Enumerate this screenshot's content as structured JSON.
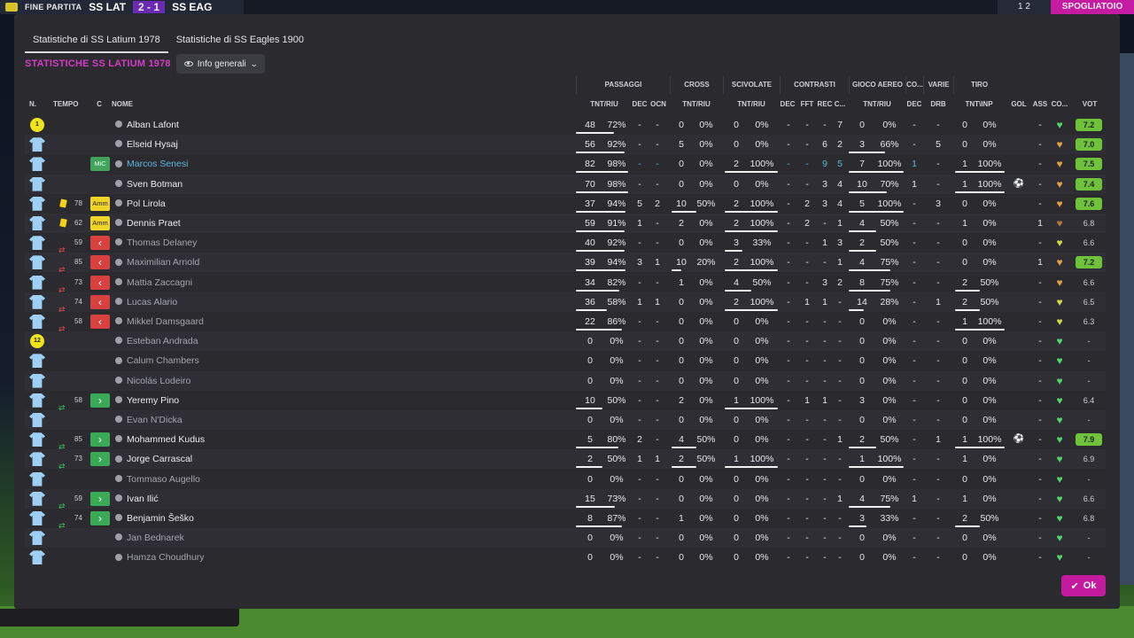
{
  "topbar": {
    "match_label": "FINE PARTITA",
    "home": "SS LAT",
    "score": "2 - 1",
    "away": "SS EAG",
    "page": "1 2",
    "room_button": "SPOGLIATOIO"
  },
  "tabs": [
    {
      "label": "Statistiche di SS Latium 1978",
      "active": true
    },
    {
      "label": "Statistiche di SS Eagles 1900",
      "active": false
    }
  ],
  "section_title": "STATISTICHE SS LATIUM 1978",
  "view_dropdown": "Info generali",
  "groups": [
    "PASSAGGI",
    "CROSS",
    "SCIVOLATE",
    "CONTRASTI",
    "GIOCO AEREO",
    "CO...",
    "VARIE",
    "TIRO"
  ],
  "headers": {
    "n": "N.",
    "tempo": "TEMPO",
    "c": "C",
    "nome": "NOME",
    "pass_tr": "TNT/RIU",
    "pass_dec": "DEC",
    "pass_ocn": "OCN",
    "cross_tr": "TNT/RIU",
    "sciv_tr": "TNT/RIU",
    "con_dec": "DEC",
    "con_fft": "FFT",
    "con_rec": "REC",
    "con_c": "C...",
    "aer_tr": "TNT/RIU",
    "co_dec": "DEC",
    "var_drb": "DRB",
    "tiro_tr": "TNT\\INP",
    "gol": "GOL",
    "ass": "ASS",
    "cond": "CO...",
    "vot": "VOT"
  },
  "colors": {
    "accent": "#c41b9e",
    "title": "#d43cc6",
    "vote_high": "#6ec33a",
    "vote_mid": "#9bd34a",
    "shirt": "#9dd0f4",
    "heart_green": "#4ed66a",
    "heart_orange": "#e0a040",
    "heart_yellow": "#cfd84a"
  },
  "players": [
    {
      "n": "1",
      "gk": true,
      "tempo": "",
      "tag": "",
      "tagType": "",
      "name": "Alban Lafont",
      "style": "",
      "pt": "48",
      "pr": "72%",
      "pd": "-",
      "po": "-",
      "ct": "0",
      "cr": "0%",
      "st": "0",
      "sr": "0%",
      "cd": "-",
      "cf": "-",
      "cre": "-",
      "cc": "7",
      "at": "0",
      "ar": "0%",
      "cod": "-",
      "drb": "-",
      "tt": "0",
      "tr": "0%",
      "gol": "",
      "ass": "-",
      "heart": "green",
      "vot": "7.2",
      "votStyle": "high",
      "passFill": 0.72,
      "crossFill": 0,
      "scivFill": 0,
      "aerFill": 0,
      "tiroFill": 0
    },
    {
      "n": "",
      "gk": false,
      "tempo": "",
      "tag": "",
      "tagType": "",
      "name": "Elseid Hysaj",
      "style": "",
      "pt": "56",
      "pr": "92%",
      "pd": "-",
      "po": "-",
      "ct": "5",
      "cr": "0%",
      "st": "0",
      "sr": "0%",
      "cd": "-",
      "cf": "-",
      "cre": "6",
      "cc": "2",
      "at": "3",
      "ar": "66%",
      "cod": "-",
      "drb": "5",
      "tt": "0",
      "tr": "0%",
      "gol": "",
      "ass": "-",
      "heart": "orange",
      "vot": "7.0",
      "votStyle": "high",
      "passFill": 0.92,
      "crossFill": 0,
      "scivFill": 0,
      "aerFill": 0.66,
      "tiroFill": 0
    },
    {
      "n": "",
      "gk": false,
      "tempo": "",
      "tag": "MiC",
      "tagType": "mic",
      "name": "Marcos Senesi",
      "style": "link",
      "pt": "82",
      "pr": "98%",
      "pd": "-",
      "po": "-",
      "ct": "0",
      "cr": "0%",
      "st": "2",
      "sr": "100%",
      "cd": "-",
      "cf": "-",
      "cre": "9",
      "cc": "5",
      "at": "7",
      "ar": "100%",
      "cod": "1",
      "drb": "-",
      "tt": "1",
      "tr": "100%",
      "gol": "",
      "ass": "-",
      "heart": "orange",
      "vot": "7.5",
      "votStyle": "high",
      "passFill": 0.98,
      "crossFill": 0,
      "scivFill": 1,
      "aerFill": 1,
      "tiroFill": 1,
      "teal": true
    },
    {
      "n": "",
      "gk": false,
      "tempo": "",
      "tag": "",
      "tagType": "",
      "name": "Sven Botman",
      "style": "",
      "pt": "70",
      "pr": "98%",
      "pd": "-",
      "po": "-",
      "ct": "0",
      "cr": "0%",
      "st": "0",
      "sr": "0%",
      "cd": "-",
      "cf": "-",
      "cre": "3",
      "cc": "4",
      "at": "10",
      "ar": "70%",
      "cod": "1",
      "drb": "-",
      "tt": "1",
      "tr": "100%",
      "gol": "⚽",
      "ass": "-",
      "heart": "orange",
      "vot": "7.4",
      "votStyle": "high",
      "passFill": 0.98,
      "crossFill": 0,
      "scivFill": 0,
      "aerFill": 0.7,
      "tiroFill": 1
    },
    {
      "n": "",
      "gk": false,
      "tempo": "78",
      "tempoIcon": "yellow",
      "tag": "Amm",
      "tagType": "amm",
      "name": "Pol Lirola",
      "style": "",
      "pt": "37",
      "pr": "94%",
      "pd": "5",
      "po": "2",
      "ct": "10",
      "cr": "50%",
      "st": "2",
      "sr": "100%",
      "cd": "-",
      "cf": "2",
      "cre": "3",
      "cc": "4",
      "at": "5",
      "ar": "100%",
      "cod": "-",
      "drb": "3",
      "tt": "0",
      "tr": "0%",
      "gol": "",
      "ass": "-",
      "heart": "orange",
      "vot": "7.6",
      "votStyle": "high",
      "passFill": 0.94,
      "crossFill": 0.5,
      "scivFill": 1,
      "aerFill": 1,
      "tiroFill": 0
    },
    {
      "n": "",
      "gk": false,
      "tempo": "62",
      "tempoIcon": "yellow",
      "tag": "Amm",
      "tagType": "amm",
      "name": "Dennis Praet",
      "style": "",
      "pt": "59",
      "pr": "91%",
      "pd": "1",
      "po": "-",
      "ct": "2",
      "cr": "0%",
      "st": "2",
      "sr": "100%",
      "cd": "-",
      "cf": "2",
      "cre": "-",
      "cc": "1",
      "at": "4",
      "ar": "50%",
      "cod": "-",
      "drb": "-",
      "tt": "1",
      "tr": "0%",
      "gol": "",
      "ass": "1",
      "heart": "brown",
      "vot": "6.8",
      "votStyle": "plain",
      "passFill": 0.91,
      "crossFill": 0,
      "scivFill": 1,
      "aerFill": 0.5,
      "tiroFill": 0
    },
    {
      "n": "",
      "gk": false,
      "tempo": "59",
      "tempoIcon": "out",
      "tag": "‹",
      "tagType": "out",
      "name": "Thomas Delaney",
      "style": "sub",
      "pt": "40",
      "pr": "92%",
      "pd": "-",
      "po": "-",
      "ct": "0",
      "cr": "0%",
      "st": "3",
      "sr": "33%",
      "cd": "-",
      "cf": "-",
      "cre": "1",
      "cc": "3",
      "at": "2",
      "ar": "50%",
      "cod": "-",
      "drb": "-",
      "tt": "0",
      "tr": "0%",
      "gol": "",
      "ass": "-",
      "heart": "yellow",
      "vot": "6.6",
      "votStyle": "plain",
      "passFill": 0.92,
      "crossFill": 0,
      "scivFill": 0.33,
      "aerFill": 0.5,
      "tiroFill": 0
    },
    {
      "n": "",
      "gk": false,
      "tempo": "85",
      "tempoIcon": "out",
      "tag": "‹",
      "tagType": "out",
      "name": "Maximilian Arnold",
      "style": "sub",
      "pt": "39",
      "pr": "94%",
      "pd": "3",
      "po": "1",
      "ct": "10",
      "cr": "20%",
      "st": "2",
      "sr": "100%",
      "cd": "-",
      "cf": "-",
      "cre": "-",
      "cc": "1",
      "at": "4",
      "ar": "75%",
      "cod": "-",
      "drb": "-",
      "tt": "0",
      "tr": "0%",
      "gol": "",
      "ass": "1",
      "heart": "orange",
      "vot": "7.2",
      "votStyle": "high",
      "passFill": 0.94,
      "crossFill": 0.2,
      "scivFill": 1,
      "aerFill": 0.75,
      "tiroFill": 0
    },
    {
      "n": "",
      "gk": false,
      "tempo": "73",
      "tempoIcon": "out",
      "tag": "‹",
      "tagType": "out",
      "name": "Mattia Zaccagni",
      "style": "sub",
      "pt": "34",
      "pr": "82%",
      "pd": "-",
      "po": "-",
      "ct": "1",
      "cr": "0%",
      "st": "4",
      "sr": "50%",
      "cd": "-",
      "cf": "-",
      "cre": "3",
      "cc": "2",
      "at": "8",
      "ar": "75%",
      "cod": "-",
      "drb": "-",
      "tt": "2",
      "tr": "50%",
      "gol": "",
      "ass": "-",
      "heart": "orange",
      "vot": "6.6",
      "votStyle": "plain",
      "passFill": 0.82,
      "crossFill": 0,
      "scivFill": 0.5,
      "aerFill": 0.75,
      "tiroFill": 0.5
    },
    {
      "n": "",
      "gk": false,
      "tempo": "74",
      "tempoIcon": "out",
      "tag": "‹",
      "tagType": "out",
      "name": "Lucas Alario",
      "style": "sub",
      "pt": "36",
      "pr": "58%",
      "pd": "1",
      "po": "1",
      "ct": "0",
      "cr": "0%",
      "st": "2",
      "sr": "100%",
      "cd": "-",
      "cf": "1",
      "cre": "1",
      "cc": "-",
      "at": "14",
      "ar": "28%",
      "cod": "-",
      "drb": "1",
      "tt": "2",
      "tr": "50%",
      "gol": "",
      "ass": "-",
      "heart": "yellow",
      "vot": "6.5",
      "votStyle": "plain",
      "passFill": 0.58,
      "crossFill": 0,
      "scivFill": 1,
      "aerFill": 0.28,
      "tiroFill": 0.5
    },
    {
      "n": "",
      "gk": false,
      "tempo": "58",
      "tempoIcon": "out",
      "tag": "‹",
      "tagType": "out",
      "name": "Mikkel Damsgaard",
      "style": "sub",
      "pt": "22",
      "pr": "86%",
      "pd": "-",
      "po": "-",
      "ct": "0",
      "cr": "0%",
      "st": "0",
      "sr": "0%",
      "cd": "-",
      "cf": "-",
      "cre": "-",
      "cc": "-",
      "at": "0",
      "ar": "0%",
      "cod": "-",
      "drb": "-",
      "tt": "1",
      "tr": "100%",
      "gol": "",
      "ass": "-",
      "heart": "yellow",
      "vot": "6.3",
      "votStyle": "plain",
      "passFill": 0.86,
      "crossFill": 0,
      "scivFill": 0,
      "aerFill": 0,
      "tiroFill": 1
    },
    {
      "n": "12",
      "gk": true,
      "tempo": "",
      "tag": "",
      "tagType": "",
      "name": "Esteban Andrada",
      "style": "sub",
      "pt": "0",
      "pr": "0%",
      "pd": "-",
      "po": "-",
      "ct": "0",
      "cr": "0%",
      "st": "0",
      "sr": "0%",
      "cd": "-",
      "cf": "-",
      "cre": "-",
      "cc": "-",
      "at": "0",
      "ar": "0%",
      "cod": "-",
      "drb": "-",
      "tt": "0",
      "tr": "0%",
      "gol": "",
      "ass": "-",
      "heart": "green",
      "vot": "-",
      "votStyle": "plain",
      "passFill": 0,
      "crossFill": 0,
      "scivFill": 0,
      "aerFill": 0,
      "tiroFill": 0
    },
    {
      "n": "",
      "gk": false,
      "tempo": "",
      "tag": "",
      "tagType": "",
      "name": "Calum Chambers",
      "style": "sub",
      "pt": "0",
      "pr": "0%",
      "pd": "-",
      "po": "-",
      "ct": "0",
      "cr": "0%",
      "st": "0",
      "sr": "0%",
      "cd": "-",
      "cf": "-",
      "cre": "-",
      "cc": "-",
      "at": "0",
      "ar": "0%",
      "cod": "-",
      "drb": "-",
      "tt": "0",
      "tr": "0%",
      "gol": "",
      "ass": "-",
      "heart": "green",
      "vot": "-",
      "votStyle": "plain",
      "passFill": 0,
      "crossFill": 0,
      "scivFill": 0,
      "aerFill": 0,
      "tiroFill": 0
    },
    {
      "n": "",
      "gk": false,
      "tempo": "",
      "tag": "",
      "tagType": "",
      "name": "Nicolás Lodeiro",
      "style": "sub",
      "pt": "0",
      "pr": "0%",
      "pd": "-",
      "po": "-",
      "ct": "0",
      "cr": "0%",
      "st": "0",
      "sr": "0%",
      "cd": "-",
      "cf": "-",
      "cre": "-",
      "cc": "-",
      "at": "0",
      "ar": "0%",
      "cod": "-",
      "drb": "-",
      "tt": "0",
      "tr": "0%",
      "gol": "",
      "ass": "-",
      "heart": "green",
      "vot": "-",
      "votStyle": "plain",
      "passFill": 0,
      "crossFill": 0,
      "scivFill": 0,
      "aerFill": 0,
      "tiroFill": 0
    },
    {
      "n": "",
      "gk": false,
      "tempo": "58",
      "tempoIcon": "in",
      "tag": "›",
      "tagType": "in",
      "name": "Yeremy Pino",
      "style": "",
      "pt": "10",
      "pr": "50%",
      "pd": "-",
      "po": "-",
      "ct": "2",
      "cr": "0%",
      "st": "1",
      "sr": "100%",
      "cd": "-",
      "cf": "1",
      "cre": "1",
      "cc": "-",
      "at": "3",
      "ar": "0%",
      "cod": "-",
      "drb": "-",
      "tt": "0",
      "tr": "0%",
      "gol": "",
      "ass": "-",
      "heart": "green",
      "vot": "6.4",
      "votStyle": "plain",
      "passFill": 0.5,
      "crossFill": 0,
      "scivFill": 1,
      "aerFill": 0,
      "tiroFill": 0
    },
    {
      "n": "",
      "gk": false,
      "tempo": "",
      "tag": "",
      "tagType": "",
      "name": "Evan N'Dicka",
      "style": "sub",
      "pt": "0",
      "pr": "0%",
      "pd": "-",
      "po": "-",
      "ct": "0",
      "cr": "0%",
      "st": "0",
      "sr": "0%",
      "cd": "-",
      "cf": "-",
      "cre": "-",
      "cc": "-",
      "at": "0",
      "ar": "0%",
      "cod": "-",
      "drb": "-",
      "tt": "0",
      "tr": "0%",
      "gol": "",
      "ass": "-",
      "heart": "green",
      "vot": "-",
      "votStyle": "plain",
      "passFill": 0,
      "crossFill": 0,
      "scivFill": 0,
      "aerFill": 0,
      "tiroFill": 0
    },
    {
      "n": "",
      "gk": false,
      "tempo": "85",
      "tempoIcon": "in",
      "tag": "›",
      "tagType": "in",
      "name": "Mohammed Kudus",
      "style": "",
      "pt": "5",
      "pr": "80%",
      "pd": "2",
      "po": "-",
      "ct": "4",
      "cr": "50%",
      "st": "0",
      "sr": "0%",
      "cd": "-",
      "cf": "-",
      "cre": "-",
      "cc": "1",
      "at": "2",
      "ar": "50%",
      "cod": "-",
      "drb": "1",
      "tt": "1",
      "tr": "100%",
      "gol": "⚽",
      "ass": "-",
      "heart": "green",
      "vot": "7.9",
      "votStyle": "high",
      "passFill": 0.8,
      "crossFill": 0.5,
      "scivFill": 0,
      "aerFill": 0.5,
      "tiroFill": 1
    },
    {
      "n": "",
      "gk": false,
      "tempo": "73",
      "tempoIcon": "in",
      "tag": "›",
      "tagType": "in",
      "name": "Jorge Carrascal",
      "style": "",
      "pt": "2",
      "pr": "50%",
      "pd": "1",
      "po": "1",
      "ct": "2",
      "cr": "50%",
      "st": "1",
      "sr": "100%",
      "cd": "-",
      "cf": "-",
      "cre": "-",
      "cc": "-",
      "at": "1",
      "ar": "100%",
      "cod": "-",
      "drb": "-",
      "tt": "1",
      "tr": "0%",
      "gol": "",
      "ass": "-",
      "heart": "green",
      "vot": "6.9",
      "votStyle": "plain",
      "passFill": 0.5,
      "crossFill": 0.5,
      "scivFill": 1,
      "aerFill": 1,
      "tiroFill": 0
    },
    {
      "n": "",
      "gk": false,
      "tempo": "",
      "tag": "",
      "tagType": "",
      "name": "Tommaso Augello",
      "style": "sub",
      "pt": "0",
      "pr": "0%",
      "pd": "-",
      "po": "-",
      "ct": "0",
      "cr": "0%",
      "st": "0",
      "sr": "0%",
      "cd": "-",
      "cf": "-",
      "cre": "-",
      "cc": "-",
      "at": "0",
      "ar": "0%",
      "cod": "-",
      "drb": "-",
      "tt": "0",
      "tr": "0%",
      "gol": "",
      "ass": "-",
      "heart": "green",
      "vot": "-",
      "votStyle": "plain",
      "passFill": 0,
      "crossFill": 0,
      "scivFill": 0,
      "aerFill": 0,
      "tiroFill": 0
    },
    {
      "n": "",
      "gk": false,
      "tempo": "59",
      "tempoIcon": "in",
      "tag": "›",
      "tagType": "in",
      "name": "Ivan Ilić",
      "style": "",
      "pt": "15",
      "pr": "73%",
      "pd": "-",
      "po": "-",
      "ct": "0",
      "cr": "0%",
      "st": "0",
      "sr": "0%",
      "cd": "-",
      "cf": "-",
      "cre": "-",
      "cc": "1",
      "at": "4",
      "ar": "75%",
      "cod": "1",
      "drb": "-",
      "tt": "1",
      "tr": "0%",
      "gol": "",
      "ass": "-",
      "heart": "green",
      "vot": "6.6",
      "votStyle": "plain",
      "passFill": 0.73,
      "crossFill": 0,
      "scivFill": 0,
      "aerFill": 0.75,
      "tiroFill": 0
    },
    {
      "n": "",
      "gk": false,
      "tempo": "74",
      "tempoIcon": "in",
      "tag": "›",
      "tagType": "in",
      "name": "Benjamin Šeško",
      "style": "",
      "pt": "8",
      "pr": "87%",
      "pd": "-",
      "po": "-",
      "ct": "1",
      "cr": "0%",
      "st": "0",
      "sr": "0%",
      "cd": "-",
      "cf": "-",
      "cre": "-",
      "cc": "-",
      "at": "3",
      "ar": "33%",
      "cod": "-",
      "drb": "-",
      "tt": "2",
      "tr": "50%",
      "gol": "",
      "ass": "-",
      "heart": "green",
      "vot": "6.8",
      "votStyle": "plain",
      "passFill": 0.87,
      "crossFill": 0,
      "scivFill": 0,
      "aerFill": 0.33,
      "tiroFill": 0.5
    },
    {
      "n": "",
      "gk": false,
      "tempo": "",
      "tag": "",
      "tagType": "",
      "name": "Jan Bednarek",
      "style": "sub",
      "pt": "0",
      "pr": "0%",
      "pd": "-",
      "po": "-",
      "ct": "0",
      "cr": "0%",
      "st": "0",
      "sr": "0%",
      "cd": "-",
      "cf": "-",
      "cre": "-",
      "cc": "-",
      "at": "0",
      "ar": "0%",
      "cod": "-",
      "drb": "-",
      "tt": "0",
      "tr": "0%",
      "gol": "",
      "ass": "-",
      "heart": "green",
      "vot": "-",
      "votStyle": "plain",
      "passFill": 0,
      "crossFill": 0,
      "scivFill": 0,
      "aerFill": 0,
      "tiroFill": 0
    },
    {
      "n": "",
      "gk": false,
      "tempo": "",
      "tag": "",
      "tagType": "",
      "name": "Hamza Choudhury",
      "style": "sub",
      "pt": "0",
      "pr": "0%",
      "pd": "-",
      "po": "-",
      "ct": "0",
      "cr": "0%",
      "st": "0",
      "sr": "0%",
      "cd": "-",
      "cf": "-",
      "cre": "-",
      "cc": "-",
      "at": "0",
      "ar": "0%",
      "cod": "-",
      "drb": "-",
      "tt": "0",
      "tr": "0%",
      "gol": "",
      "ass": "-",
      "heart": "green",
      "vot": "-",
      "votStyle": "plain",
      "passFill": 0,
      "crossFill": 0,
      "scivFill": 0,
      "aerFill": 0,
      "tiroFill": 0
    }
  ],
  "ok_button": "Ok"
}
